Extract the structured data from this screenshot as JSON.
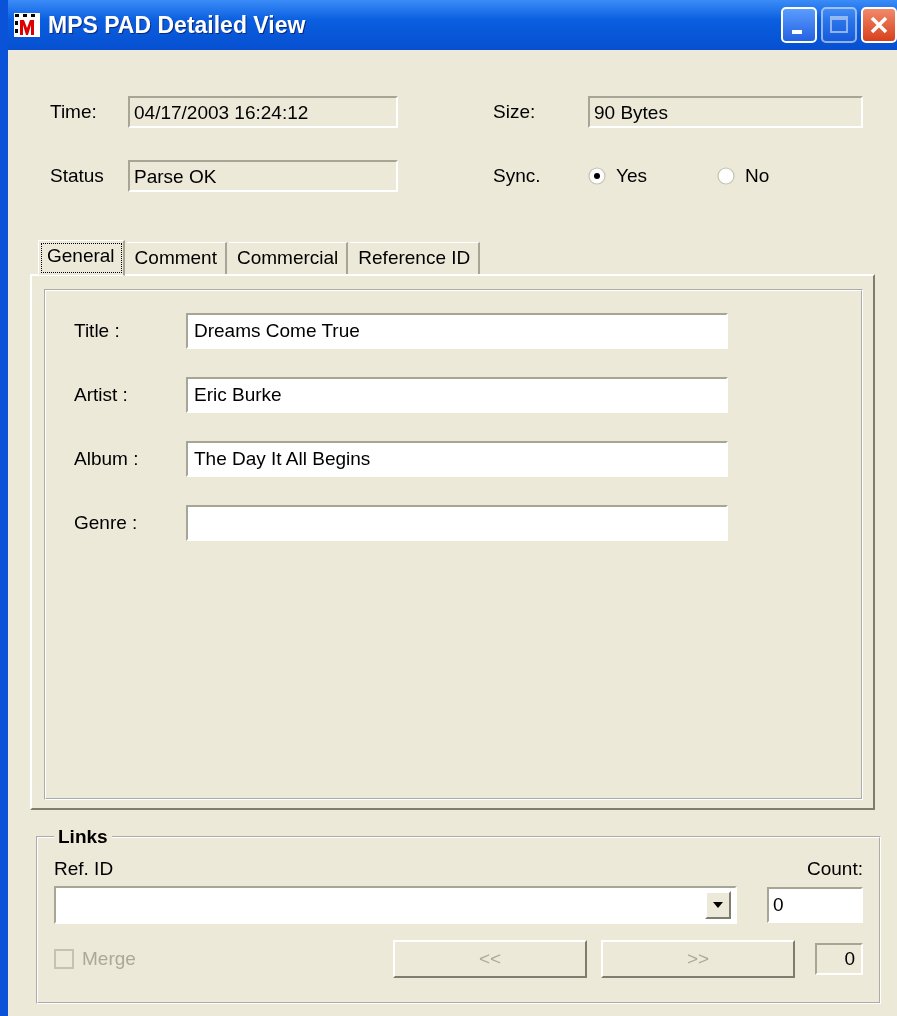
{
  "window": {
    "title": "MPS PAD Detailed View",
    "controls": [
      {
        "kind": "minimize",
        "disabled": false
      },
      {
        "kind": "maximize",
        "disabled": true
      },
      {
        "kind": "close",
        "disabled": false
      }
    ]
  },
  "info": {
    "time": {
      "label": "Time:",
      "value": "04/17/2003 16:24:12"
    },
    "size": {
      "label": "Size:",
      "value": "90 Bytes"
    },
    "status": {
      "label": "Status",
      "value": "Parse OK"
    },
    "sync": {
      "label": "Sync.",
      "options": [
        {
          "label": "Yes",
          "selected": true
        },
        {
          "label": "No",
          "selected": false
        }
      ]
    }
  },
  "tabs": [
    {
      "label": "General",
      "selected": true
    },
    {
      "label": "Comment",
      "selected": false
    },
    {
      "label": "Commercial",
      "selected": false
    },
    {
      "label": "Reference ID",
      "selected": false
    }
  ],
  "fields": [
    {
      "label": "Title :",
      "value": "Dreams Come True"
    },
    {
      "label": "Artist :",
      "value": "Eric Burke"
    },
    {
      "label": "Album :",
      "value": "The Day It All Begins"
    },
    {
      "label": "Genre :"
    }
  ],
  "links": {
    "legend": "Links",
    "ref_label": "Ref. ID",
    "count_label": "Count:",
    "count_value": "0",
    "merge": {
      "label": "Merge",
      "checked": false,
      "disabled": true
    },
    "buttons": [
      {
        "label": "<<",
        "disabled": true
      },
      {
        "label": ">>",
        "disabled": true
      }
    ],
    "index": "0"
  }
}
